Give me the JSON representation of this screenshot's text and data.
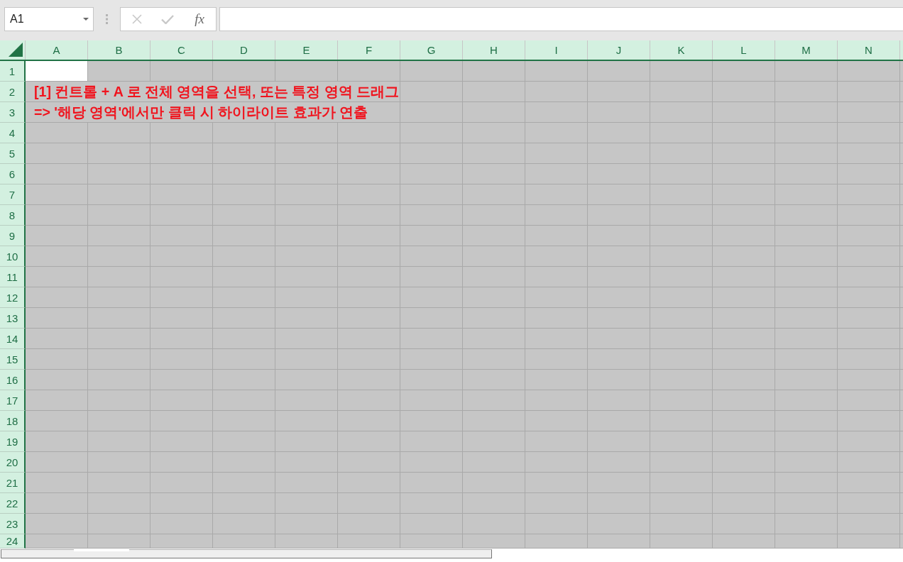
{
  "name_box": {
    "value": "A1"
  },
  "formula_buttons": [
    {
      "kind": "cancel",
      "disabled": true
    },
    {
      "kind": "enter",
      "disabled": true
    },
    {
      "kind": "insert_function",
      "label": "fx",
      "disabled": false
    }
  ],
  "sheet": {
    "all_selected": true,
    "columns": [
      "A",
      "B",
      "C",
      "D",
      "E",
      "F",
      "G",
      "H",
      "I",
      "J",
      "K",
      "L",
      "M",
      "N"
    ],
    "rows": [
      {
        "header": "1"
      },
      {
        "header": "2",
        "column_a": "[1] 컨트롤 + A 로 전체 영역을 선택, 또는 특정 영역 드래그"
      },
      {
        "header": "3",
        "column_a": "=> '해당 영역'에서만 클릭 시 하이라이트 효과가 연출"
      },
      {
        "header": "4"
      },
      {
        "header": "5"
      },
      {
        "header": "6"
      },
      {
        "header": "7"
      },
      {
        "header": "8"
      },
      {
        "header": "9"
      },
      {
        "header": "10"
      },
      {
        "header": "11"
      },
      {
        "header": "12"
      },
      {
        "header": "13"
      },
      {
        "header": "14"
      },
      {
        "header": "15"
      },
      {
        "header": "16"
      },
      {
        "header": "17"
      },
      {
        "header": "18"
      },
      {
        "header": "19"
      },
      {
        "header": "20"
      },
      {
        "header": "21"
      },
      {
        "header": "22"
      },
      {
        "header": "23"
      },
      {
        "header": "24"
      }
    ]
  }
}
